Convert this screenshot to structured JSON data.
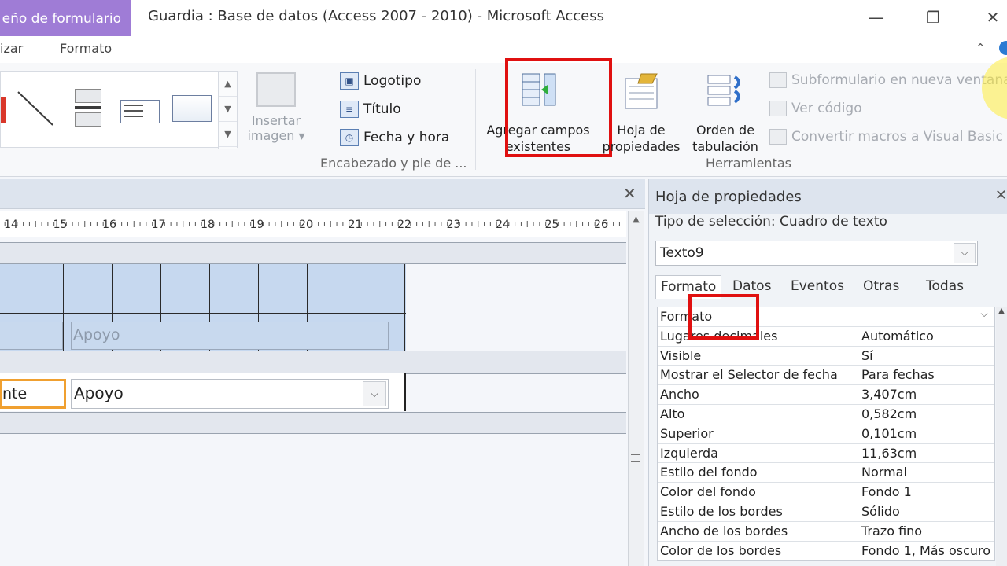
{
  "window": {
    "context_tab": "eño de formulario",
    "title": "Guardia : Base de datos (Access 2007 - 2010)  -  Microsoft Access",
    "minimize_icon": "minimize-icon",
    "restore_icon": "restore-icon",
    "close_icon": "close-icon"
  },
  "ribbon_tabs": [
    {
      "label": "izar"
    },
    {
      "label": "Formato"
    }
  ],
  "ribbon": {
    "insert_image": {
      "line1": "Insertar",
      "line2": "imagen ▾"
    },
    "header_footer": {
      "items": [
        {
          "label": "Logotipo",
          "icon": "logo-icon"
        },
        {
          "label": "Título",
          "icon": "title-icon"
        },
        {
          "label": "Fecha y hora",
          "icon": "date-time-icon"
        }
      ],
      "group_label": "Encabezado y pie de ..."
    },
    "add_fields": {
      "line1": "Agregar campos",
      "line2": "existentes"
    },
    "property_sheet": {
      "line1": "Hoja de",
      "line2": "propiedades"
    },
    "tab_order": {
      "line1": "Orden de",
      "line2": "tabulación"
    },
    "tools": {
      "items": [
        {
          "label": "Subformulario en nueva ventana"
        },
        {
          "label": "Ver código"
        },
        {
          "label": "Convertir macros a Visual Basic"
        }
      ],
      "group_label": "Herramientas"
    }
  },
  "designer": {
    "ruler_labels": [
      "14",
      "15",
      "16",
      "17",
      "18",
      "19",
      "20",
      "21",
      "22",
      "23",
      "24",
      "25",
      "26"
    ],
    "header_label": "Apoyo",
    "detail_left_text": "nte",
    "combo_value": "Apoyo"
  },
  "properties": {
    "title": "Hoja de propiedades",
    "selection_type": "Tipo de selección:  Cuadro de texto",
    "object": "Texto9",
    "tabs": [
      "Formato",
      "Datos",
      "Eventos",
      "Otras",
      "Todas"
    ],
    "rows": [
      {
        "key": "Formato",
        "value": ""
      },
      {
        "key": "Lugares decimales",
        "value": "Automático"
      },
      {
        "key": "Visible",
        "value": "Sí"
      },
      {
        "key": "Mostrar el Selector de fecha",
        "value": "Para fechas"
      },
      {
        "key": "Ancho",
        "value": "3,407cm"
      },
      {
        "key": "Alto",
        "value": "0,582cm"
      },
      {
        "key": "Superior",
        "value": "0,101cm"
      },
      {
        "key": "Izquierda",
        "value": "11,63cm"
      },
      {
        "key": "Estilo del fondo",
        "value": "Normal"
      },
      {
        "key": "Color del fondo",
        "value": "Fondo 1"
      },
      {
        "key": "Estilo de los bordes",
        "value": "Sólido"
      },
      {
        "key": "Ancho de los bordes",
        "value": "Trazo fino"
      },
      {
        "key": "Color de los bordes",
        "value": "Fondo 1, Más oscuro"
      }
    ]
  },
  "colors": {
    "context_tab": "#9f7cd6",
    "highlight": "#e01010",
    "grid_fill": "#c6d8ef",
    "focus_border": "#f0a030"
  }
}
